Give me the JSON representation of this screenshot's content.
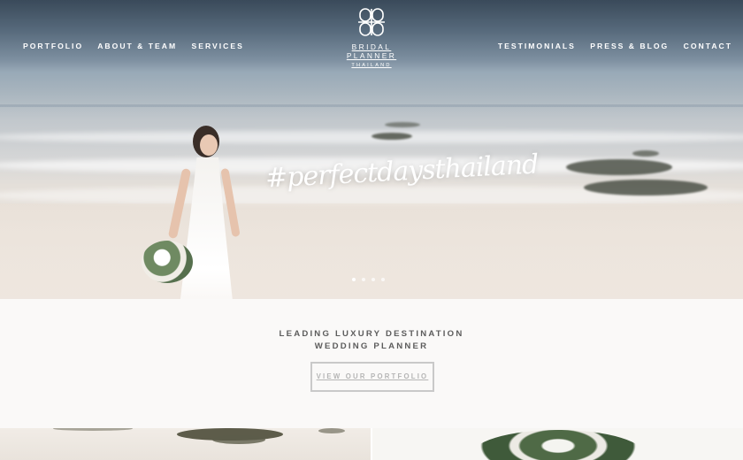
{
  "site": {
    "logo_name": "BRIDAL PLANNER",
    "logo_sub": "THAILAND",
    "logo_icon": "monogram-knot-icon"
  },
  "nav": {
    "left": [
      {
        "label": "PORTFOLIO"
      },
      {
        "label": "ABOUT & TEAM"
      },
      {
        "label": "SERVICES"
      }
    ],
    "right": [
      {
        "label": "TESTIMONIALS"
      },
      {
        "label": "PRESS & BLOG"
      },
      {
        "label": "CONTACT"
      }
    ]
  },
  "hero": {
    "hashtag": "#perfectdaysthailand",
    "slides_total": 4,
    "slide_active": 1
  },
  "intro": {
    "tagline_line1": "LEADING LUXURY DESTINATION",
    "tagline_line2": "WEDDING PLANNER",
    "cta_label": "VIEW OUR PORTFOLIO"
  },
  "colors": {
    "text_dark": "#5c5c5c",
    "cta_border": "#c9c9c9",
    "white": "#ffffff"
  }
}
